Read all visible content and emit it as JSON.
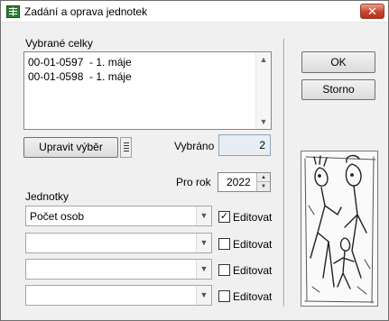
{
  "window": {
    "title": "Zadání a oprava jednotek",
    "close_label": "✕"
  },
  "selected": {
    "label": "Vybrané celky",
    "items": [
      "00-01-0597  - 1. máje",
      "00-01-0598  - 1. máje"
    ],
    "edit_button": "Upravit výběr",
    "count_label": "Vybráno",
    "count_value": "2"
  },
  "year": {
    "label": "Pro rok",
    "value": "2022"
  },
  "units": {
    "label": "Jednotky",
    "rows": [
      {
        "value": "Počet osob",
        "checked": true,
        "check_label": "Editovat"
      },
      {
        "value": "",
        "checked": false,
        "check_label": "Editovat"
      },
      {
        "value": "",
        "checked": false,
        "check_label": "Editovat"
      },
      {
        "value": "",
        "checked": false,
        "check_label": "Editovat"
      }
    ]
  },
  "actions": {
    "ok_label": "OK",
    "cancel_label": "Storno"
  },
  "icons": {
    "app": "spreadsheet-icon",
    "scroll_up": "▲",
    "scroll_down": "▼",
    "dropdown": "▼",
    "spin_up": "▲",
    "spin_down": "▼",
    "check": "✓"
  }
}
